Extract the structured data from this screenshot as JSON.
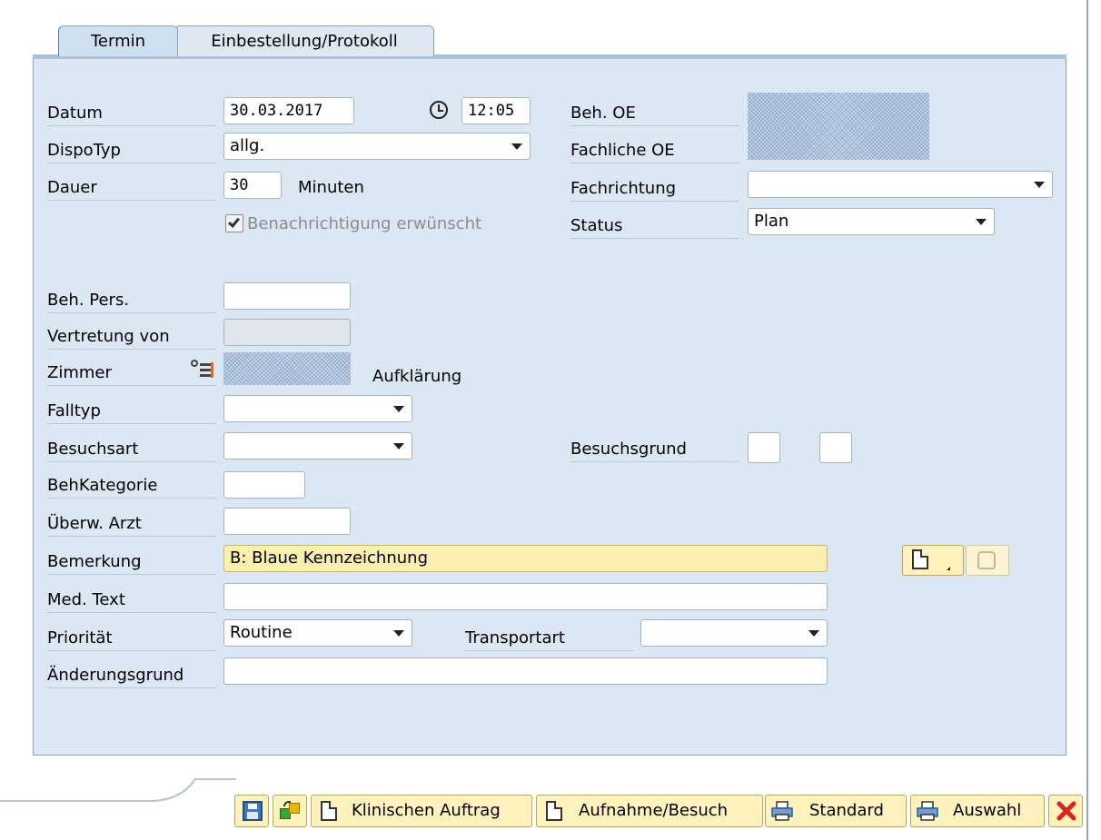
{
  "tabs": [
    {
      "label": "Termin"
    },
    {
      "label": "Einbestellung/Protokoll"
    }
  ],
  "form": {
    "datum": {
      "label": "Datum",
      "value": "30.03.2017"
    },
    "uhrzeit": {
      "value": "12:05"
    },
    "dispotyp": {
      "label": "DispoTyp",
      "value": "allg."
    },
    "dauer": {
      "label": "Dauer",
      "value": "30",
      "unit": "Minuten"
    },
    "benachrichtigung": {
      "label": "Benachrichtigung erwünscht",
      "checked": true
    },
    "beh_oe": {
      "label": "Beh. OE"
    },
    "fachliche_oe": {
      "label": "Fachliche OE"
    },
    "fachrichtung": {
      "label": "Fachrichtung",
      "value": ""
    },
    "status": {
      "label": "Status",
      "value": "Plan"
    },
    "beh_pers": {
      "label": "Beh. Pers.",
      "value": ""
    },
    "vertretung": {
      "label": "Vertretung von",
      "value": ""
    },
    "zimmer": {
      "label": "Zimmer",
      "suffix": "Aufklärung"
    },
    "falltyp": {
      "label": "Falltyp",
      "value": ""
    },
    "besuchsart": {
      "label": "Besuchsart",
      "value": ""
    },
    "besuchsgrund": {
      "label": "Besuchsgrund"
    },
    "behkategorie": {
      "label": "BehKategorie",
      "value": ""
    },
    "uberw_arzt": {
      "label": "Überw. Arzt",
      "value": ""
    },
    "bemerkung": {
      "label": "Bemerkung",
      "value": "B: Blaue Kennzeichnung"
    },
    "med_text": {
      "label": "Med. Text",
      "value": ""
    },
    "prioritaet": {
      "label": "Priorität",
      "value": "Routine"
    },
    "transportart": {
      "label": "Transportart",
      "value": ""
    },
    "aenderungsgrund": {
      "label": "Änderungsgrund",
      "value": ""
    }
  },
  "toolbar": {
    "klinischen_auftrag": "Klinischen Auftrag",
    "aufnahme_besuch": "Aufnahme/Besuch",
    "standard": "Standard",
    "auswahl": "Auswahl"
  },
  "colors": {
    "panel_bg": "#dbe7f2",
    "highlight_field": "#fbefb0",
    "button_bg": "#fff2bd",
    "cancel_red": "#d9261c"
  }
}
